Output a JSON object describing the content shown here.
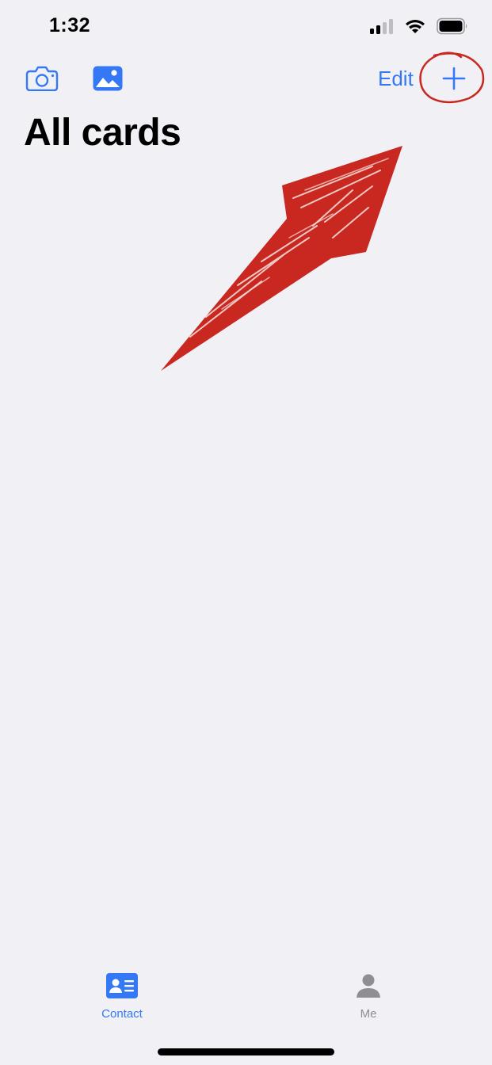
{
  "status_bar": {
    "time": "1:32",
    "icons": [
      "cellular-signal-icon",
      "wifi-icon",
      "battery-icon"
    ]
  },
  "toolbar": {
    "camera_icon": "camera-icon",
    "photo_icon": "photo-library-icon",
    "edit_label": "Edit",
    "add_icon": "plus-icon"
  },
  "page": {
    "title": "All cards"
  },
  "tabs": [
    {
      "label": "Contact",
      "icon": "contact-card-icon",
      "active": true
    },
    {
      "label": "Me",
      "icon": "person-icon",
      "active": false
    }
  ],
  "colors": {
    "accent": "#3478f6",
    "background": "#f1f0f5",
    "annotation": "#c8281f",
    "inactive_tab": "#8e8e93"
  }
}
